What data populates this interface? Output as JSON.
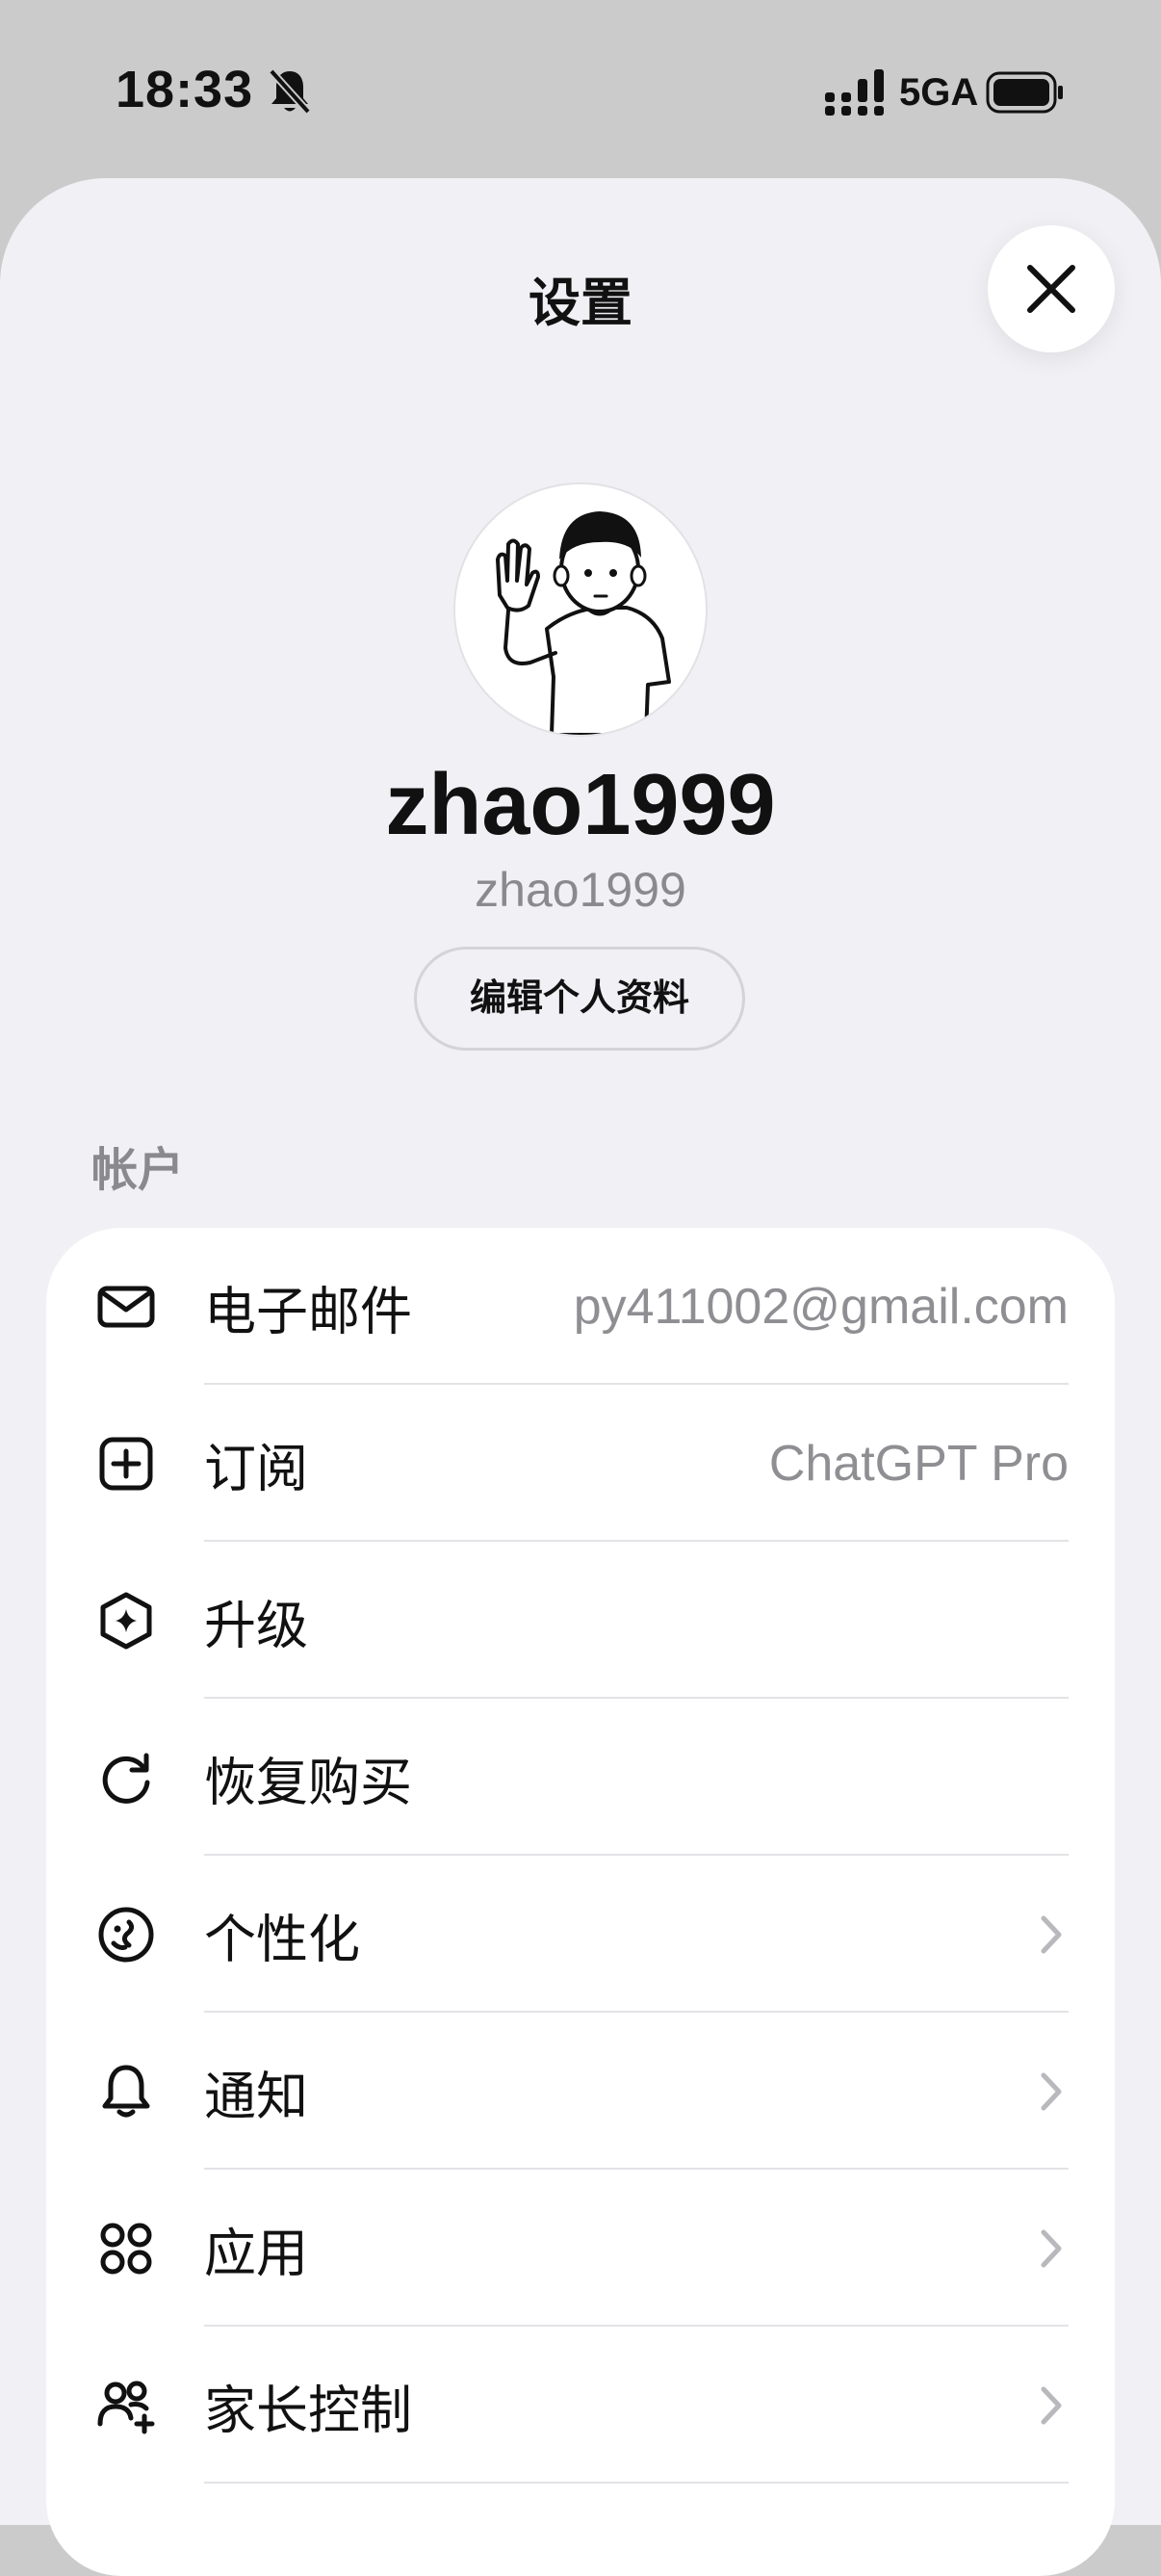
{
  "status_bar": {
    "time": "18:33",
    "network": "5GA",
    "mute_icon": "bell-slash-icon",
    "signal_icon": "signal-icon",
    "battery_icon": "battery-icon"
  },
  "header": {
    "title": "设置",
    "close_icon": "close-icon"
  },
  "profile": {
    "display_name": "zhao1999",
    "username": "zhao1999",
    "edit_button": "编辑个人资料",
    "avatar_icon": "waving-person-avatar"
  },
  "account_section": {
    "header": "帐户",
    "rows": [
      {
        "label": "电子邮件",
        "value": "py411002@gmail.com",
        "icon": "mail-icon",
        "chevron": false
      },
      {
        "label": "订阅",
        "value": "ChatGPT Pro",
        "icon": "plus-square-icon",
        "chevron": false
      },
      {
        "label": "升级",
        "value": "",
        "icon": "sparkle-hexagon-icon",
        "chevron": false
      },
      {
        "label": "恢复购买",
        "value": "",
        "icon": "refresh-icon",
        "chevron": false
      },
      {
        "label": "个性化",
        "value": "",
        "icon": "personalization-icon",
        "chevron": true
      },
      {
        "label": "通知",
        "value": "",
        "icon": "bell-icon",
        "chevron": true
      },
      {
        "label": "应用",
        "value": "",
        "icon": "apps-grid-icon",
        "chevron": true
      },
      {
        "label": "家长控制",
        "value": "",
        "icon": "family-icon",
        "chevron": true
      }
    ]
  },
  "colors": {
    "background": "#cbcbcb",
    "sheet": "#f0f0f5",
    "card": "#ffffff",
    "secondary_text": "#8a8a8e",
    "separator": "#e3e3e7"
  }
}
